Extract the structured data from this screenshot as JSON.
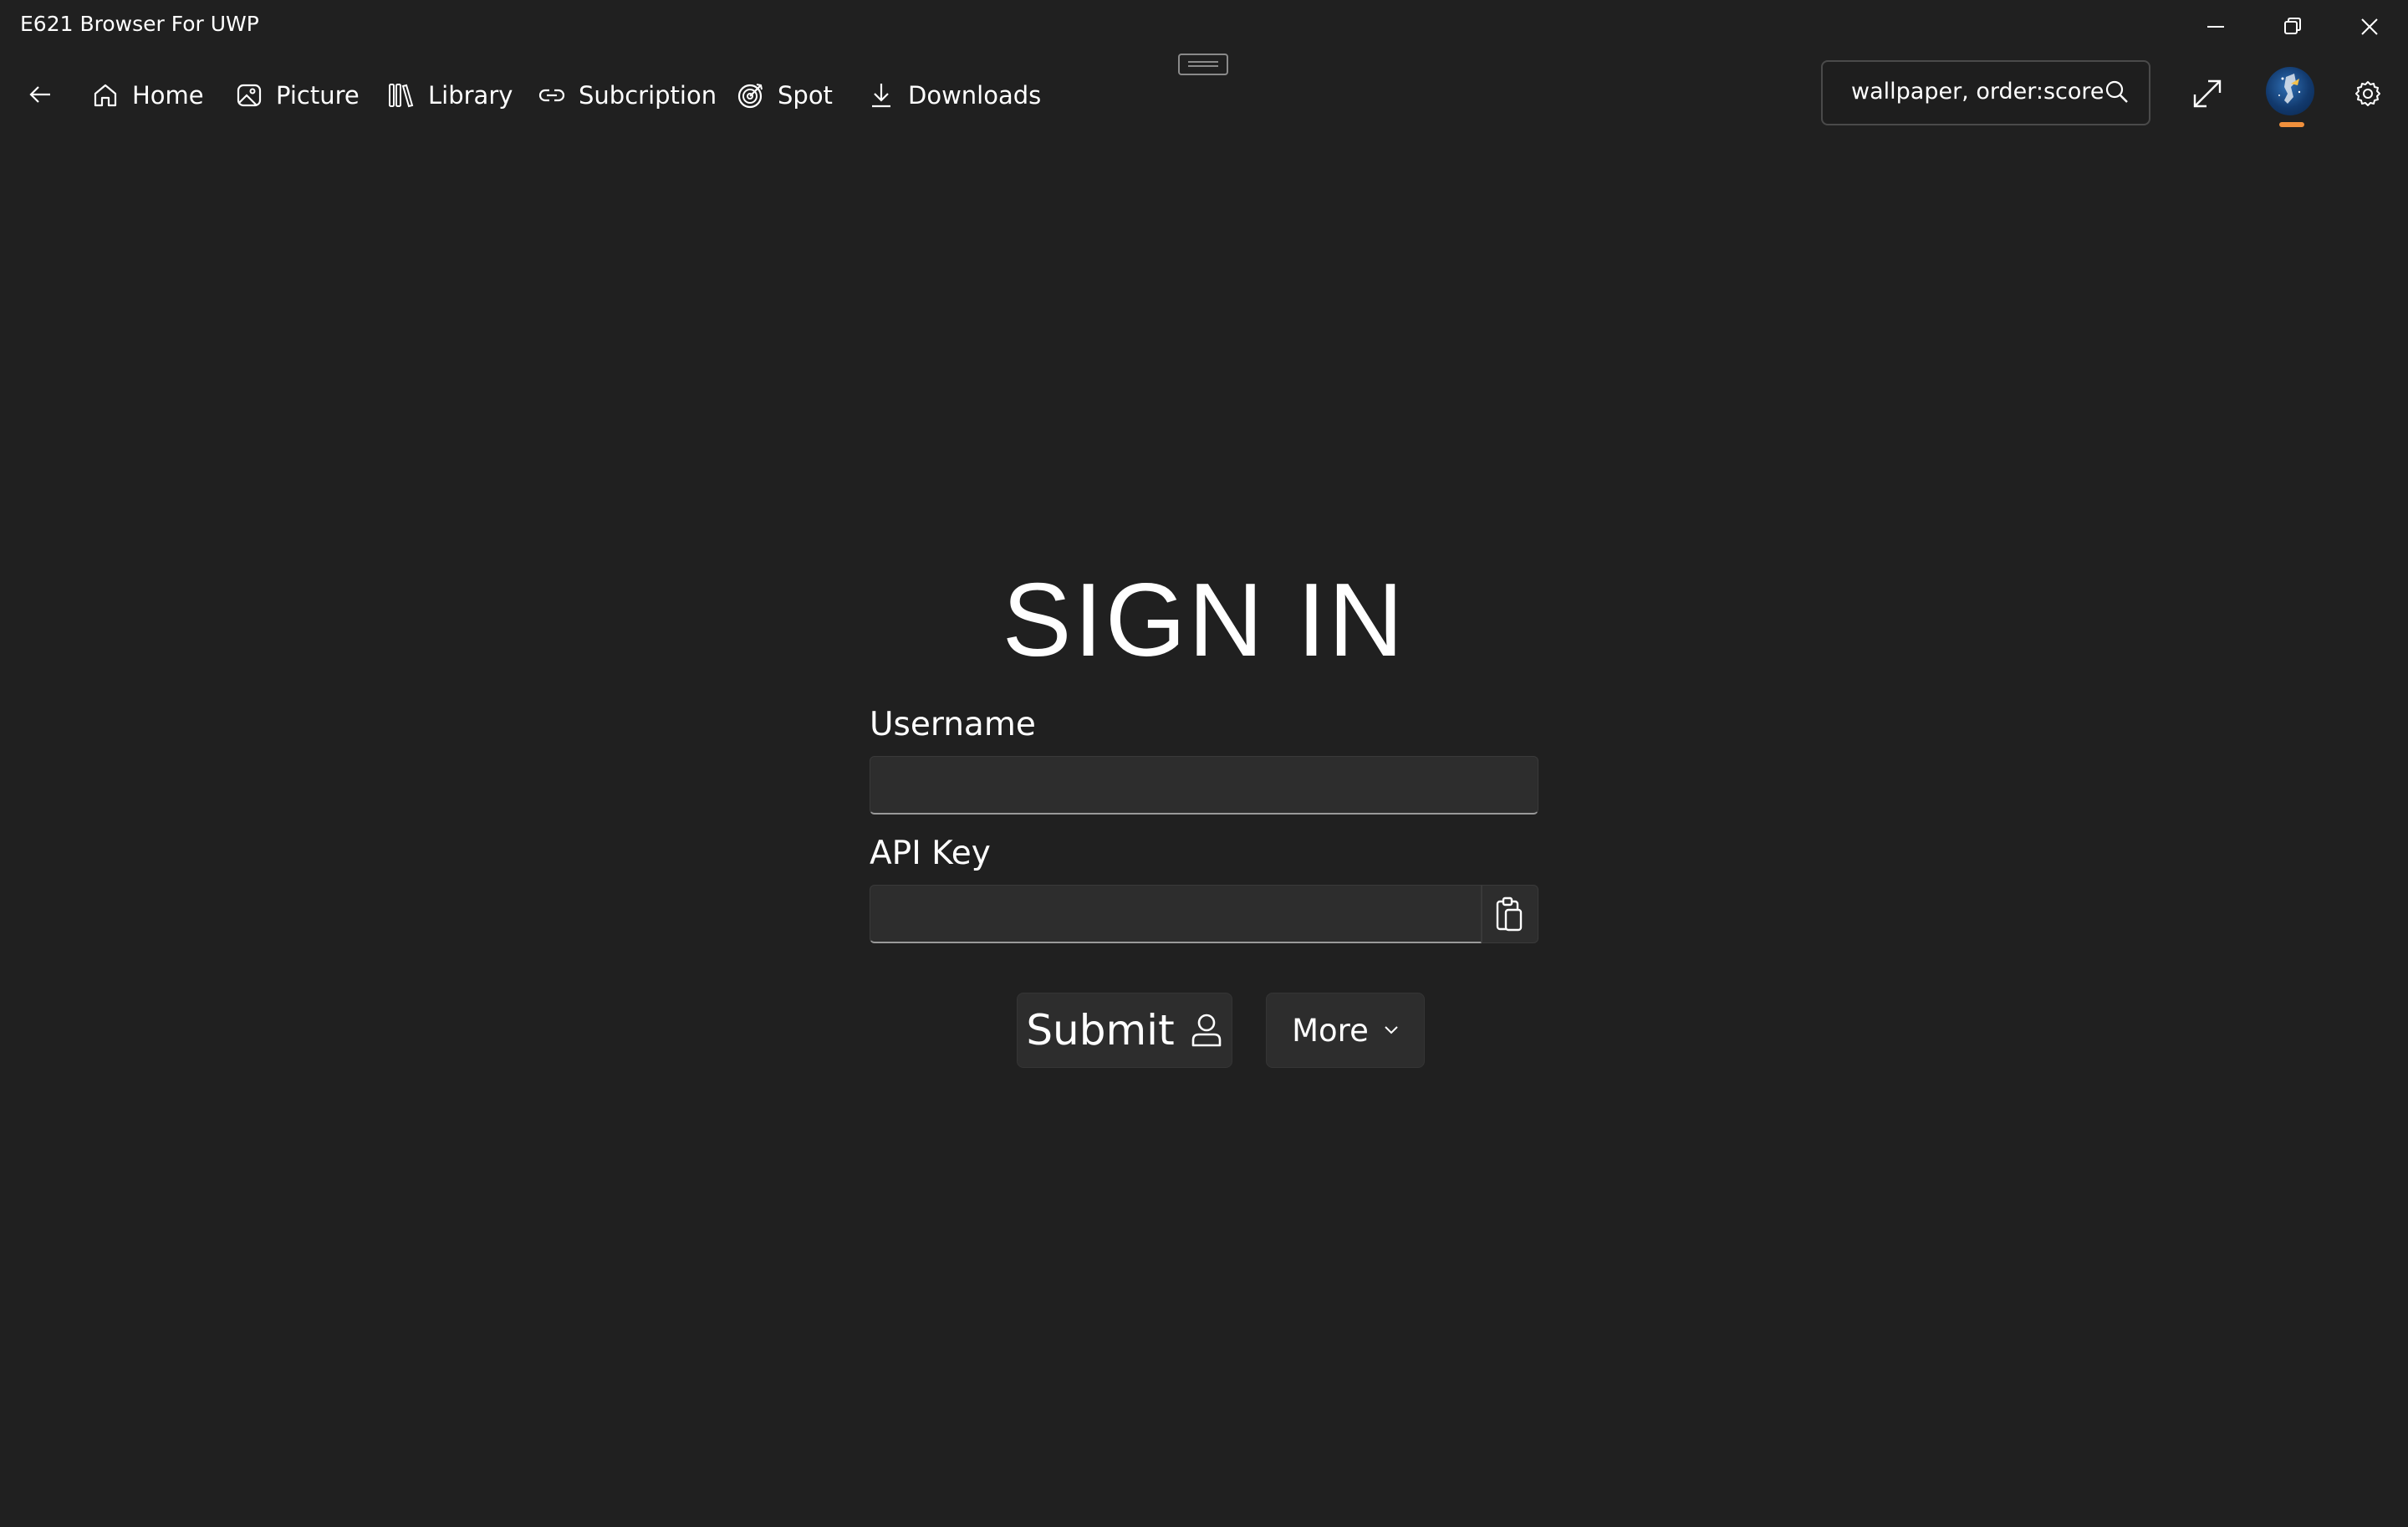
{
  "window": {
    "title": "E621 Browser For UWP"
  },
  "nav": {
    "items": [
      {
        "label": "Home",
        "icon": "home-icon"
      },
      {
        "label": "Picture",
        "icon": "picture-icon"
      },
      {
        "label": "Library",
        "icon": "library-icon"
      },
      {
        "label": "Subcription",
        "icon": "link-icon"
      },
      {
        "label": "Spot",
        "icon": "target-icon"
      },
      {
        "label": "Downloads",
        "icon": "download-icon"
      }
    ],
    "search": {
      "value": "wallpaper, order:score"
    }
  },
  "signin": {
    "title": "SIGN IN",
    "username_label": "Username",
    "username_value": "",
    "apikey_label": "API Key",
    "apikey_value": "",
    "submit_label": "Submit",
    "more_label": "More"
  },
  "colors": {
    "background": "#202020",
    "control": "#2d2d2d",
    "accent": "#f0903c",
    "text": "#ffffff"
  }
}
